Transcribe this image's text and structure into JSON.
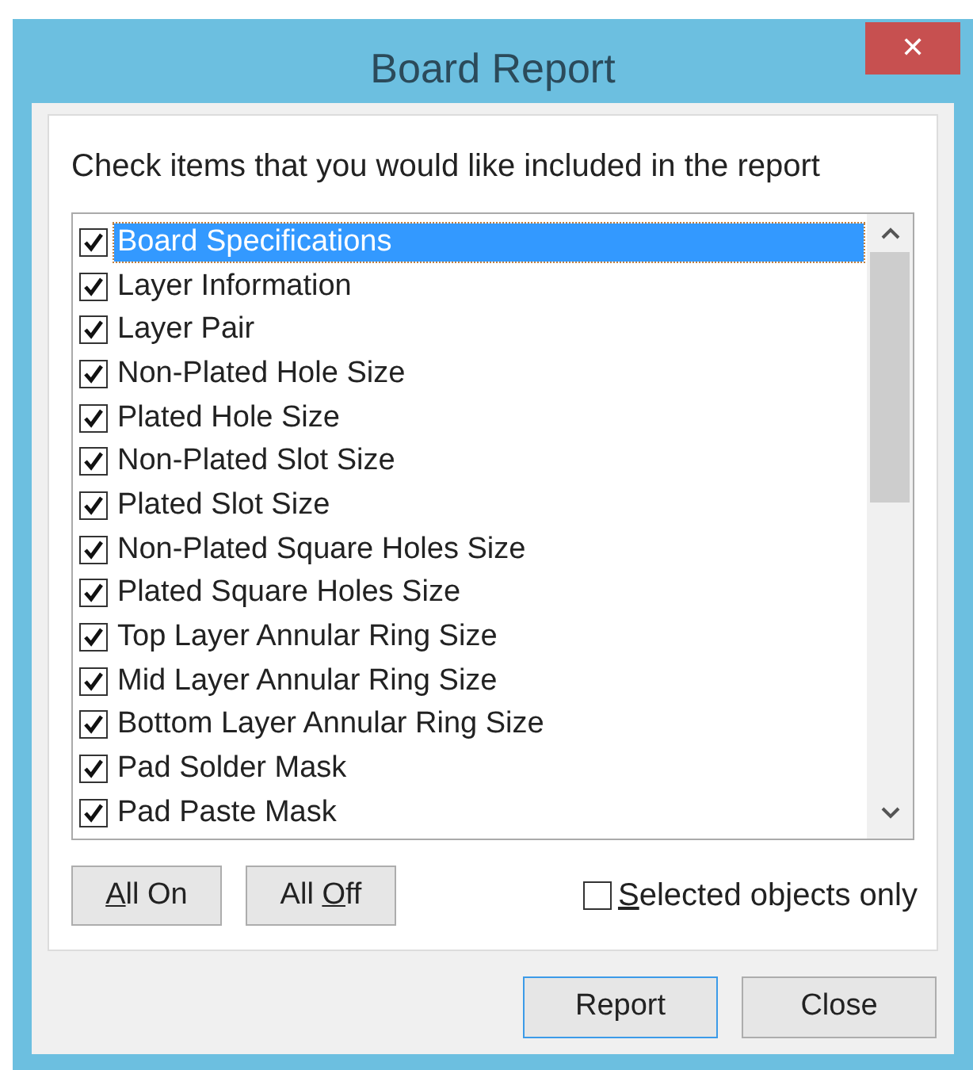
{
  "window": {
    "title": "Board Report",
    "close": "✕"
  },
  "instruction": "Check items that you would like included in the report",
  "items": [
    {
      "label": "Board Specifications",
      "checked": true,
      "selected": true
    },
    {
      "label": "Layer Information",
      "checked": true,
      "selected": false
    },
    {
      "label": "Layer Pair",
      "checked": true,
      "selected": false
    },
    {
      "label": "Non-Plated Hole Size",
      "checked": true,
      "selected": false
    },
    {
      "label": "Plated Hole Size",
      "checked": true,
      "selected": false
    },
    {
      "label": "Non-Plated Slot Size",
      "checked": true,
      "selected": false
    },
    {
      "label": "Plated Slot Size",
      "checked": true,
      "selected": false
    },
    {
      "label": "Non-Plated Square Holes Size",
      "checked": true,
      "selected": false
    },
    {
      "label": "Plated Square Holes Size",
      "checked": true,
      "selected": false
    },
    {
      "label": "Top Layer Annular Ring Size",
      "checked": true,
      "selected": false
    },
    {
      "label": "Mid Layer Annular Ring Size",
      "checked": true,
      "selected": false
    },
    {
      "label": "Bottom Layer Annular Ring Size",
      "checked": true,
      "selected": false
    },
    {
      "label": "Pad Solder Mask",
      "checked": true,
      "selected": false
    },
    {
      "label": "Pad Paste Mask",
      "checked": true,
      "selected": false
    }
  ],
  "toggle_buttons": [
    {
      "key": "A",
      "post": "ll On"
    },
    {
      "pre": "All ",
      "key": "O",
      "post": "ff"
    }
  ],
  "selected_only": {
    "key": "S",
    "post": "elected objects only",
    "checked": false
  },
  "buttons": [
    {
      "label": "Report",
      "default": true
    },
    {
      "label": "Close",
      "default": false
    }
  ]
}
